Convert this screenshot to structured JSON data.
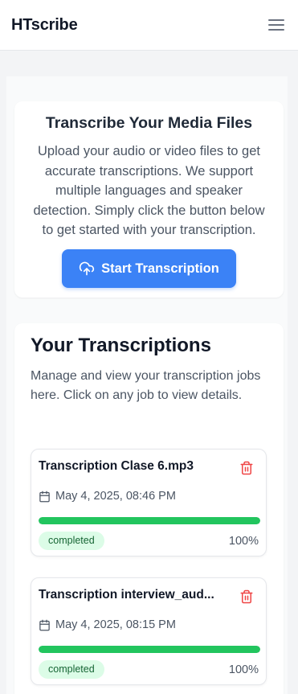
{
  "header": {
    "brand": "HTscribe"
  },
  "hero": {
    "title": "Transcribe Your Media Files",
    "description": "Upload your audio or video files to get accurate transcriptions. We support multiple languages and speaker detection. Simply click the button below to get started with your transcription.",
    "button_label": "Start Transcription"
  },
  "jobs_section": {
    "title": "Your Transcriptions",
    "description": "Manage and view your transcription jobs here. Click on any job to view details.",
    "jobs": [
      {
        "name": "Transcription Clase 6.mp3",
        "date": "May 4, 2025, 08:46 PM",
        "status": "completed",
        "progress": 100,
        "progress_label": "100%"
      },
      {
        "name": "Transcription interview_aud...",
        "date": "May 4, 2025, 08:15 PM",
        "status": "completed",
        "progress": 100,
        "progress_label": "100%"
      }
    ]
  },
  "colors": {
    "accent": "#3b82f6",
    "success": "#22c55e",
    "danger": "#ef4444"
  }
}
